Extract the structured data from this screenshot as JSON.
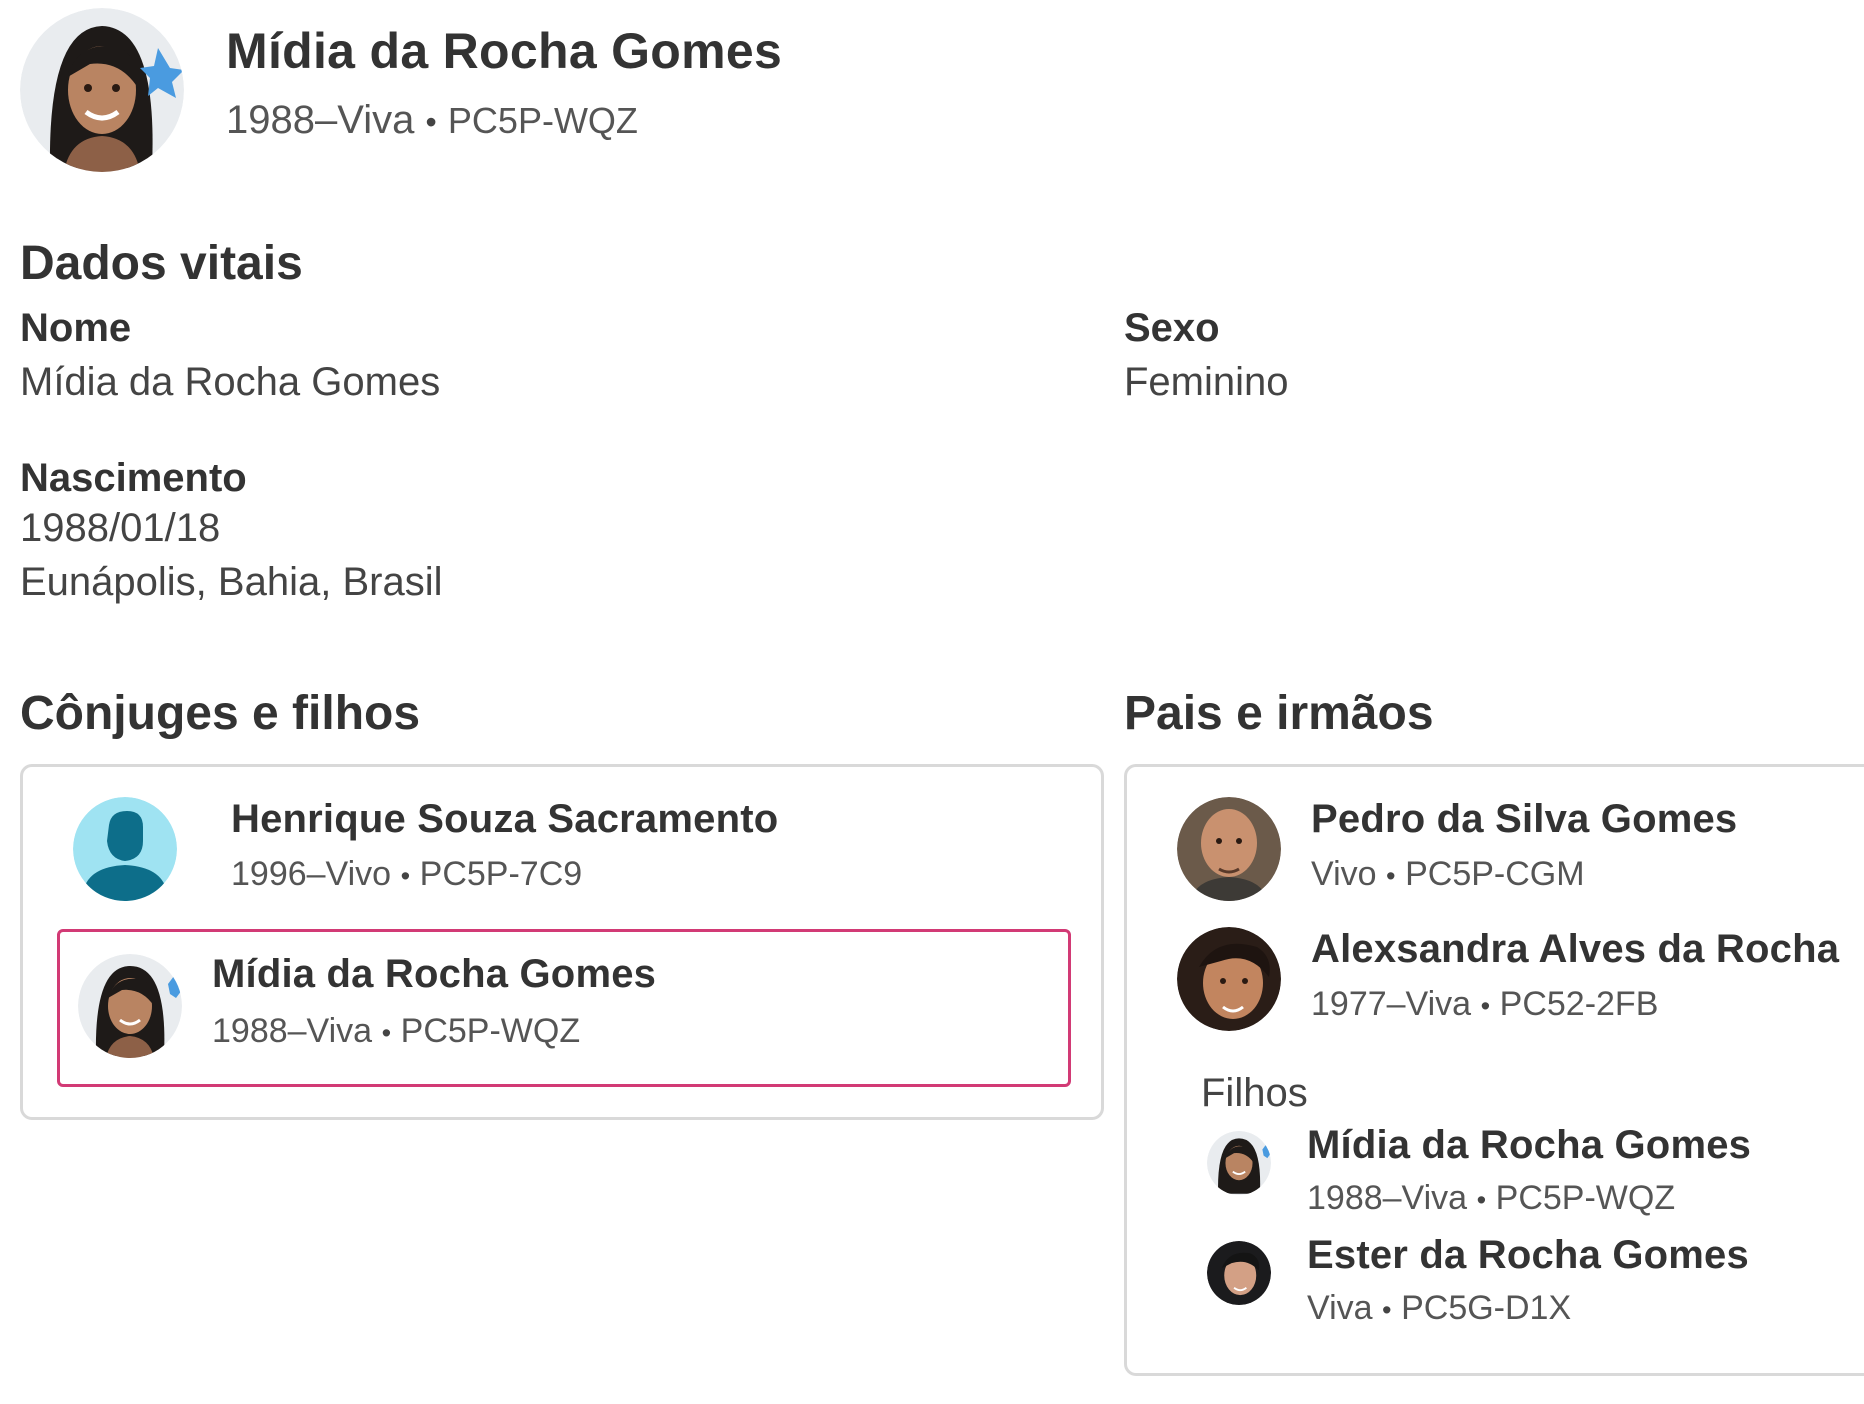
{
  "header": {
    "name": "Mídia da Rocha Gomes",
    "lifespan": "1988–Viva",
    "person_id": "PC5P-WQZ"
  },
  "vitals": {
    "title": "Dados vitais",
    "name_label": "Nome",
    "name_value": "Mídia da Rocha Gomes",
    "sex_label": "Sexo",
    "sex_value": "Feminino",
    "birth_label": "Nascimento",
    "birth_date": "1988/01/18",
    "birth_place": "Eunápolis, Bahia, Brasil"
  },
  "spouses": {
    "title": "Cônjuges e filhos",
    "spouse": {
      "name": "Henrique Souza Sacramento",
      "lifespan": "1996–Vivo",
      "id": "PC5P-7C9",
      "avatar_icon": "default-male-avatar-icon"
    },
    "self": {
      "name": "Mídia da Rocha Gomes",
      "lifespan": "1988–Viva",
      "id": "PC5P-WQZ"
    }
  },
  "parents": {
    "title": "Pais e irmãos",
    "father": {
      "name": "Pedro da Silva Gomes",
      "lifespan": "Vivo",
      "id": "PC5P-CGM"
    },
    "mother": {
      "name": "Alexsandra Alves da Rocha",
      "lifespan": "1977–Viva",
      "id": "PC52-2FB"
    },
    "children_label": "Filhos",
    "children": [
      {
        "name": "Mídia da Rocha Gomes",
        "lifespan": "1988–Viva",
        "id": "PC5P-WQZ"
      },
      {
        "name": "Ester da Rocha Gomes",
        "lifespan": "Viva",
        "id": "PC5G-D1X"
      }
    ]
  },
  "colors": {
    "selected_border": "#d23a75",
    "card_border": "#d9d9d9",
    "default_avatar_bg": "#9fe3f2",
    "default_avatar_fg": "#0d6e8a"
  }
}
